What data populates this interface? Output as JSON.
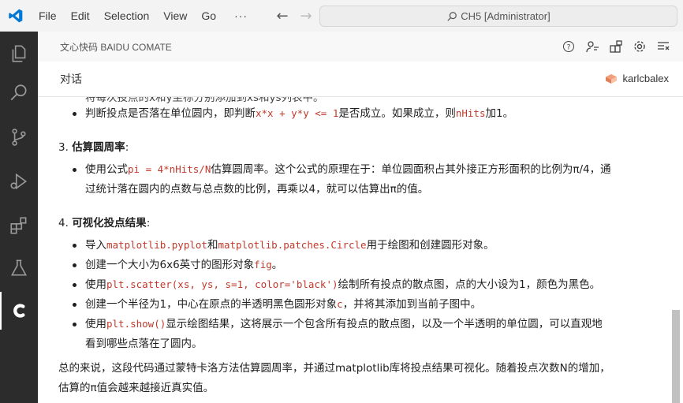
{
  "titlebar": {
    "menu": [
      "File",
      "Edit",
      "Selection",
      "View",
      "Go"
    ],
    "more": "···",
    "search": "CH5 [Administrator]"
  },
  "panel": {
    "title": "文心快码 BAIDU COMATE",
    "subtitle": "对话",
    "user": "karlcbalex"
  },
  "content": {
    "top_partial": "将每次投点的x和y坐标分别添加到xs和ys列表中。",
    "bullet_a": {
      "pre": "判断投点是否落在单位圆内，即判断",
      "code": "x*x + y*y <= 1",
      "mid": "是否成立。如果成立，则",
      "code2": "nHits",
      "post": "加1。"
    },
    "section3": {
      "num": "3.",
      "title": "估算圆周率",
      "colon": ":"
    },
    "bullet_b1": {
      "pre": "使用公式",
      "code": "pi = 4*nHits/N",
      "post": "估算圆周率。这个公式的原理在于：单位圆面积占其外接正方形面积的比例为π/4，通"
    },
    "bullet_b2": "过统计落在圆内的点数与总点数的比例，再乘以4，就可以估算出π的值。",
    "section4": {
      "num": "4.",
      "title": "可视化投点结果",
      "colon": ":"
    },
    "bullet_c1": {
      "pre": "导入",
      "code": "matplotlib.pyplot",
      "mid": "和",
      "code2": "matplotlib.patches.Circle",
      "post": "用于绘图和创建圆形对象。"
    },
    "bullet_c2": {
      "pre": "创建一个大小为6x6英寸的图形对象",
      "code": "fig",
      "post": "。"
    },
    "bullet_c3": {
      "pre": "使用",
      "code": "plt.scatter(xs, ys, s=1, color='black')",
      "post": "绘制所有投点的散点图，点的大小设为1，颜色为黑色。"
    },
    "bullet_c4": {
      "pre": "创建一个半径为1，中心在原点的半透明黑色圆形对象",
      "code": "c",
      "post": "，并将其添加到当前子图中。"
    },
    "bullet_c5a": {
      "pre": "使用",
      "code": "plt.show()",
      "post": "显示绘图结果，这将展示一个包含所有投点的散点图，以及一个半透明的单位圆，可以直观地"
    },
    "bullet_c5b": "看到哪些点落在了圆内。",
    "summary1": "总的来说，这段代码通过蒙特卡洛方法估算圆周率，并通过matplotlib库将投点结果可视化。随着投点次数N的增加，",
    "summary2": "估算的π值会越来越接近真实值。"
  },
  "colors": {
    "code": "#c0392b",
    "activity": "#2c2c2c",
    "accent": "#0078d4"
  }
}
